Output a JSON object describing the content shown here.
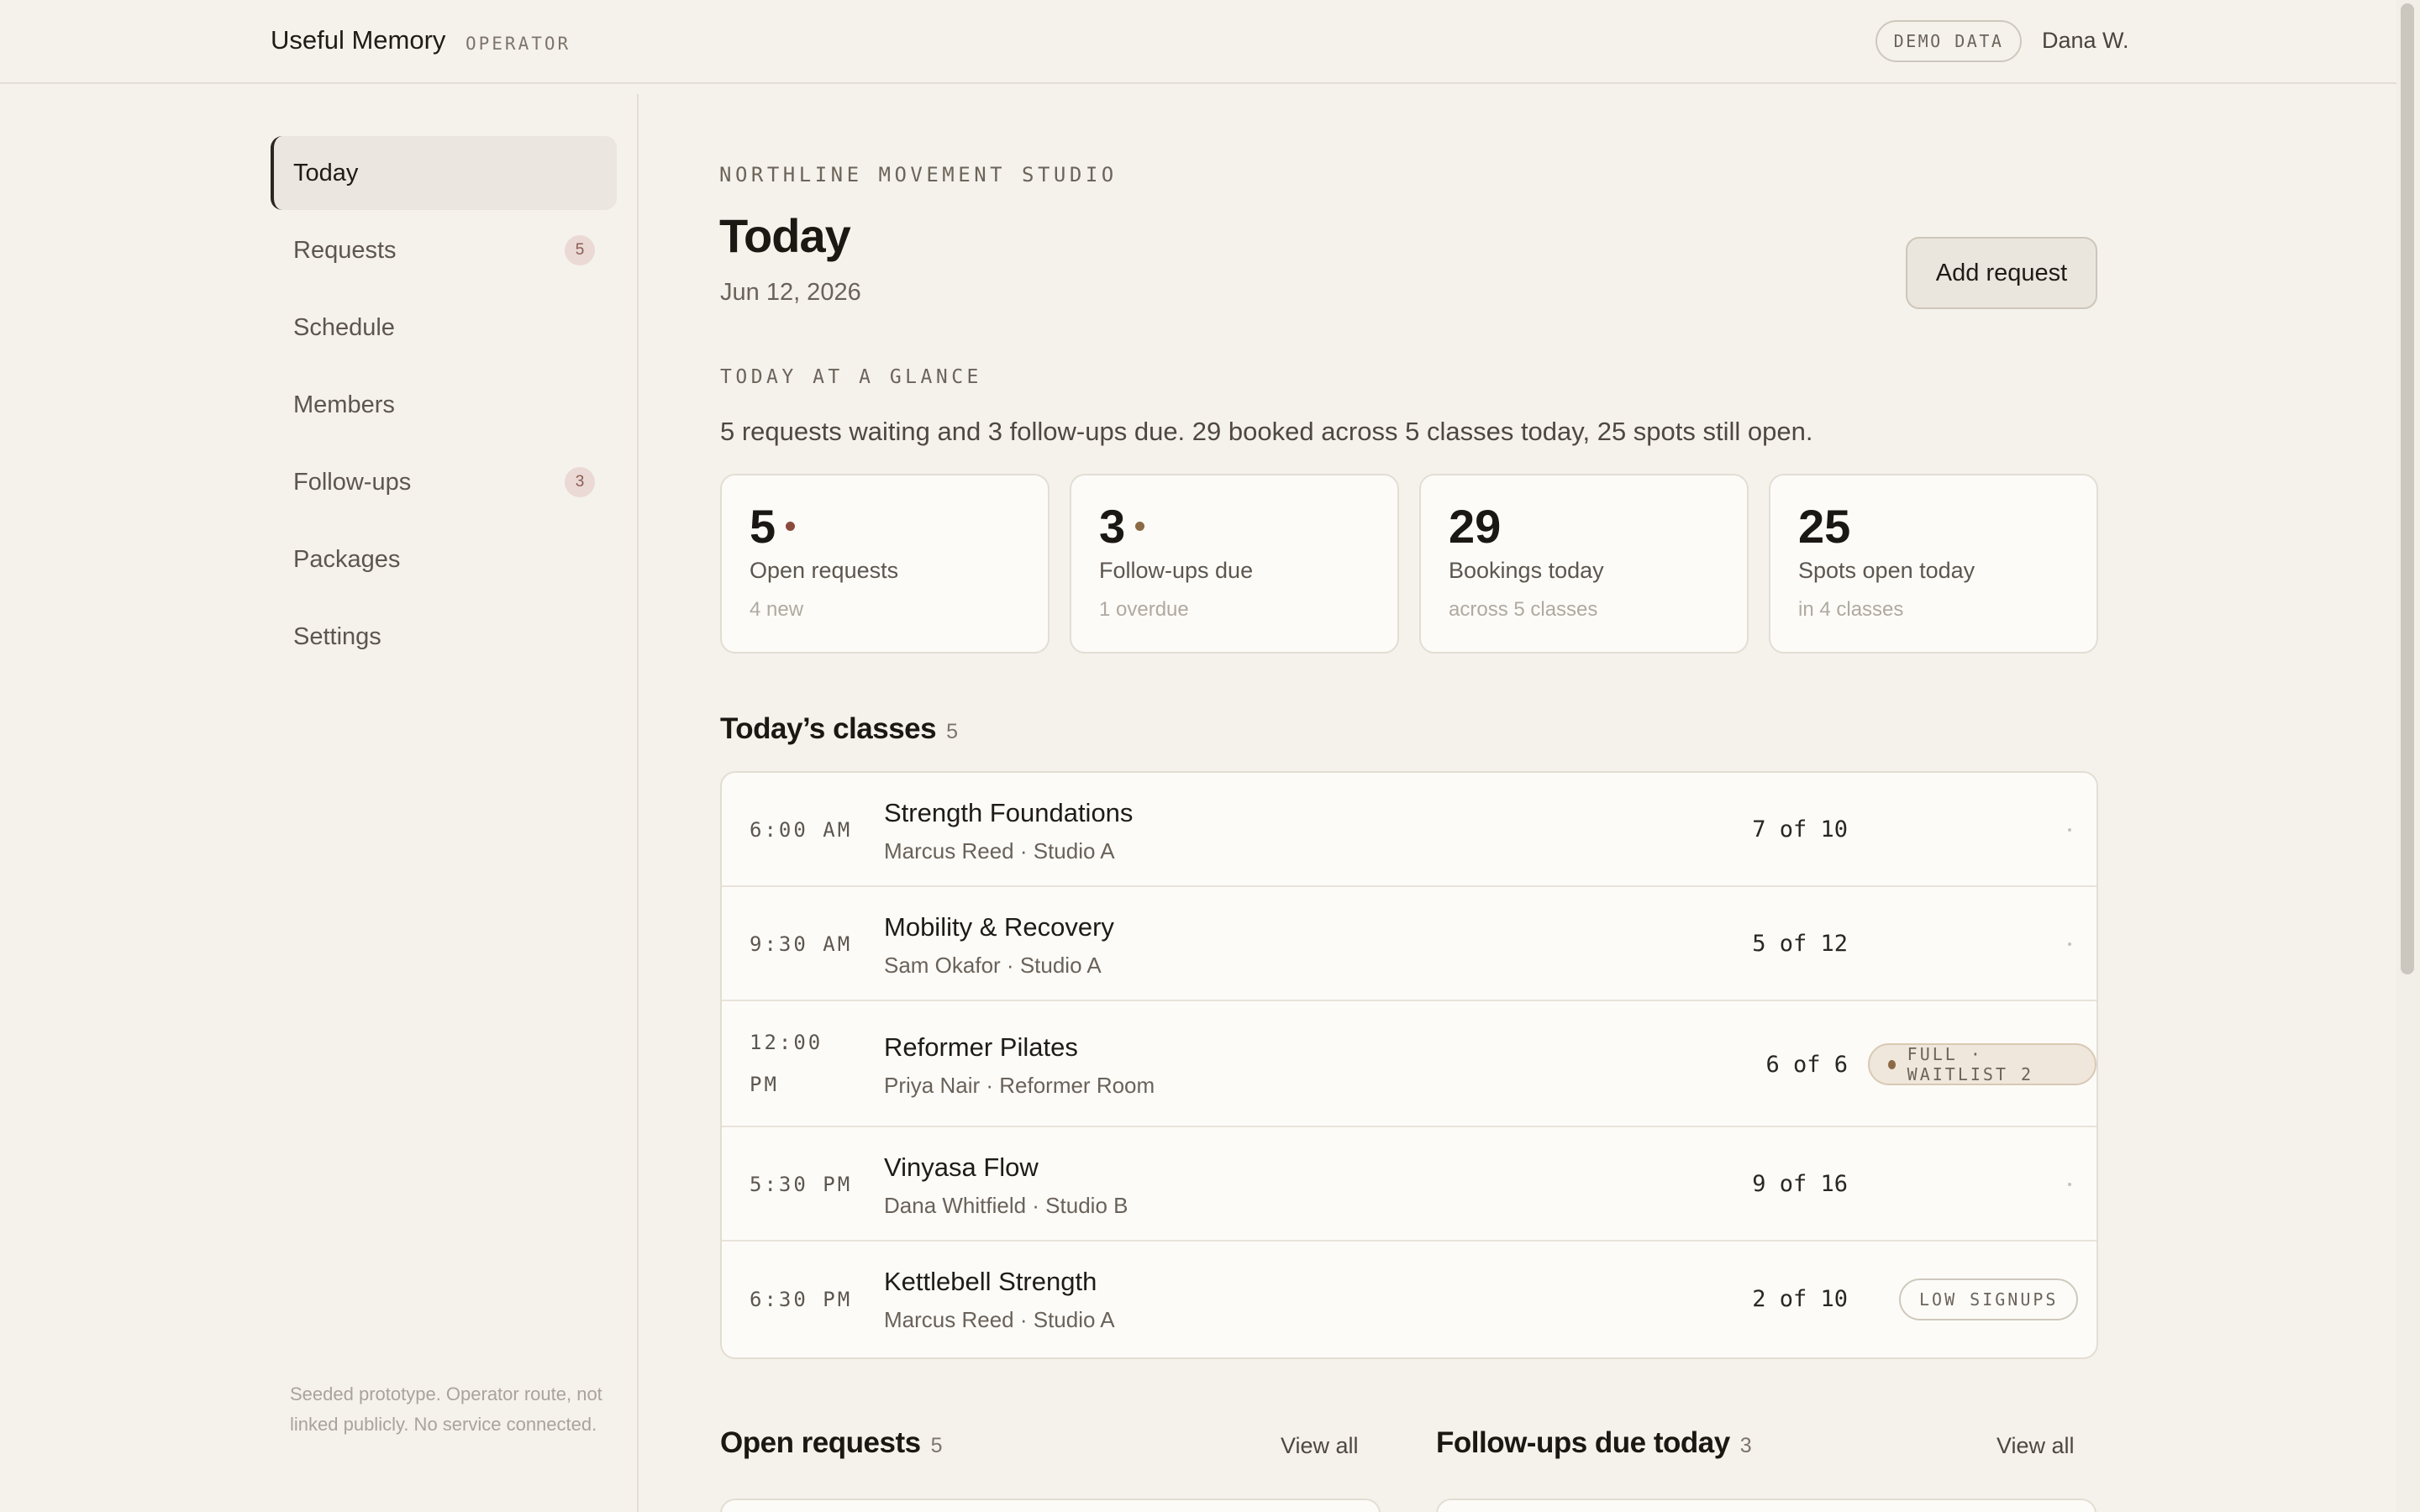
{
  "app": {
    "title": "Useful Memory",
    "subtitle": "OPERATOR"
  },
  "header": {
    "demo_label": "DEMO DATA",
    "user_name": "Dana W."
  },
  "sidebar": {
    "items": [
      {
        "label": "Today",
        "active": true
      },
      {
        "label": "Requests",
        "badge": "5"
      },
      {
        "label": "Schedule"
      },
      {
        "label": "Members"
      },
      {
        "label": "Follow-ups",
        "badge": "3"
      },
      {
        "label": "Packages"
      },
      {
        "label": "Settings"
      }
    ],
    "footer_note": "Seeded prototype. Operator route, not linked publicly. No service connected."
  },
  "main": {
    "studio": "NORTHLINE MOVEMENT STUDIO",
    "title": "Today",
    "date": "Jun 12, 2026",
    "add_button": "Add request",
    "glance_heading": "TODAY AT A GLANCE",
    "glance_summary": "5 requests waiting and 3 follow-ups due. 29 booked across 5 classes today, 25 spots still open.",
    "stats": [
      {
        "value": "5",
        "label": "Open requests",
        "sub": "4 new",
        "dot_color": "#8a4b3c"
      },
      {
        "value": "3",
        "label": "Follow-ups due",
        "sub": "1 overdue",
        "dot_color": "#8b6a45"
      },
      {
        "value": "29",
        "label": "Bookings today",
        "sub": "across 5 classes"
      },
      {
        "value": "25",
        "label": "Spots open today",
        "sub": "in 4 classes"
      }
    ],
    "classes_title": "Today’s classes",
    "classes_count": "5",
    "classes": [
      {
        "time": "6:00 AM",
        "name": "Strength Foundations",
        "meta": "Marcus Reed · Studio A",
        "capacity": "7 of 10"
      },
      {
        "time": "9:30 AM",
        "name": "Mobility & Recovery",
        "meta": "Sam Okafor · Studio A",
        "capacity": "5 of 12"
      },
      {
        "time": "12:00 PM",
        "name": "Reformer Pilates",
        "meta": "Priya Nair · Reformer Room",
        "capacity": "6 of 6",
        "status": "FULL · WAITLIST 2"
      },
      {
        "time": "5:30 PM",
        "name": "Vinyasa Flow",
        "meta": "Dana Whitfield · Studio B",
        "capacity": "9 of 16"
      },
      {
        "time": "6:30 PM",
        "name": "Kettlebell Strength",
        "meta": "Marcus Reed · Studio A",
        "capacity": "2 of 10",
        "status": "LOW SIGNUPS"
      }
    ],
    "open_requests": {
      "title": "Open requests",
      "count": "5",
      "view_all": "View all"
    },
    "followups": {
      "title": "Follow-ups due today",
      "count": "3",
      "view_all": "View all"
    }
  }
}
